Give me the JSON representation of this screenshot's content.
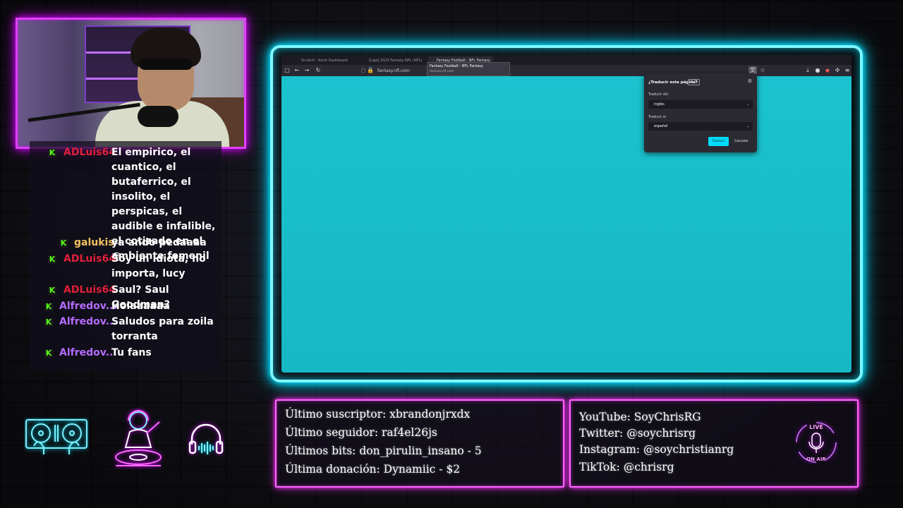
{
  "chat": {
    "messages": [
      {
        "user": "ADLuis64",
        "user_color": "#e0203a",
        "text": "El empirico, el cuantico, el butaferrico, el insolito, el perspicas, el audible e infalible, el cotizado en el ambiente femenil"
      },
      {
        "user": "galukis",
        "user_color": "#f0c060",
        "text": "ya ando pedaaaa 😜"
      },
      {
        "user": "ADLuis64",
        "user_color": "#e0203a",
        "text": "Soy un idiota, no importa, lucy"
      },
      {
        "user": "ADLuis64",
        "user_color": "#e0203a",
        "text": "Saul? Saul Goodman?"
      },
      {
        "user": "Alfredov...",
        "user_color": "#b46cff",
        "text": "Holaaaaaa"
      },
      {
        "user": "Alfredov...",
        "user_color": "#b46cff",
        "text": "Saludos para zoila torranta"
      },
      {
        "user": "Alfredov...",
        "user_color": "#b46cff",
        "text": "Tu fans"
      }
    ],
    "badge_glyph": "K"
  },
  "browser": {
    "tabs": [
      {
        "label": "Scratch - Arcot Dashboard",
        "active": false
      },
      {
        "label": "[Liga] 2023 Fantasy NFL (NFL)",
        "active": false
      },
      {
        "label": "Fantasy Football - NFL Fantasy",
        "active": true
      }
    ],
    "url": "fantasy.nfl.com",
    "tooltip": {
      "title": "Fantasy Football - NFL Fantasy",
      "subtitle": "fantasy.nfl.com"
    },
    "translate_popup": {
      "title": "¿Traducir esta página?",
      "beta": "BETA",
      "from_label": "Traducir del",
      "from_value": "inglés",
      "to_label": "Traducir al",
      "to_value": "español",
      "translate_button": "Traducir",
      "cancel_button": "Cancelar"
    },
    "page_color": "#19bfcc"
  },
  "stats_panel": {
    "last_subscriber": "Último suscriptor: xbrandonjrxdx",
    "last_follower": "Último seguidor: raf4el26js",
    "last_bits": "Últimos bits: don_pirulin_insano - 5",
    "last_donation": "Última donación: Dynamiic - $2"
  },
  "socials_panel": {
    "youtube": "YouTube: SoyChrisRG",
    "twitter": "Twitter: @soychrisrg",
    "instagram": "Instagram: @soychristianrg",
    "tiktok": "TikTok: @chrisrg",
    "live_top": "LIVE",
    "live_bottom": "ON AIR"
  },
  "colors": {
    "cyan_neon": "#00e5ff",
    "magenta_neon": "#ff33ff",
    "translate_accent": "#00ddff"
  }
}
